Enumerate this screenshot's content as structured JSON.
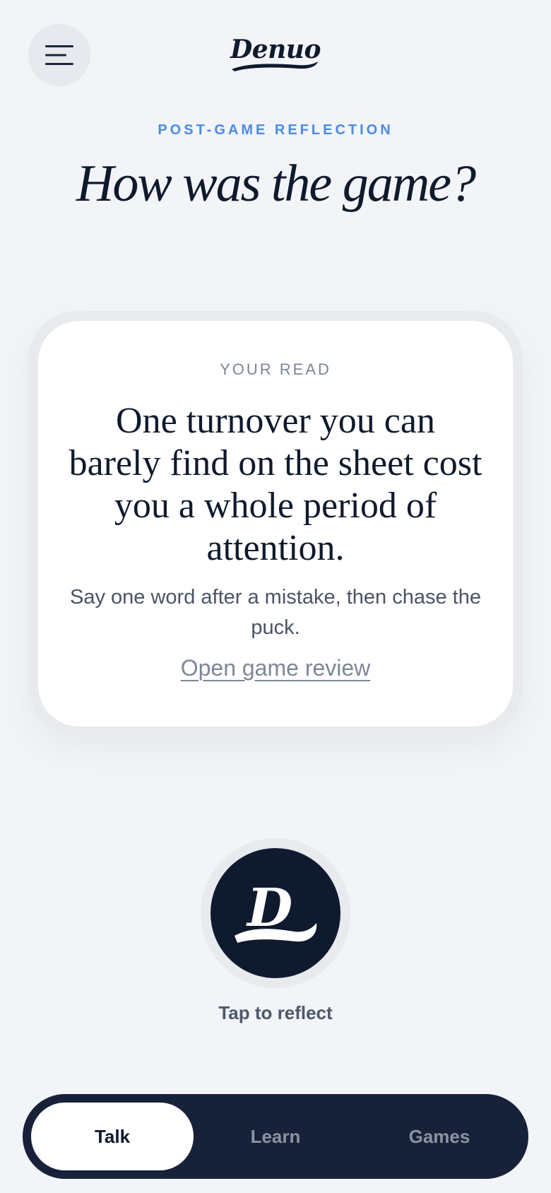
{
  "header": {
    "menu_icon": "hamburger-menu-icon",
    "logo_text": "Denuo"
  },
  "hero": {
    "eyebrow": "POST-GAME REFLECTION",
    "title": "How was the game?"
  },
  "card": {
    "label": "YOUR READ",
    "quote": "One turnover you can barely find on the sheet cost you a whole period of attention.",
    "subtext": "Say one word after a mistake, then chase the puck.",
    "link_label": "Open game review"
  },
  "reflect": {
    "icon": "denuo-d-logo-icon",
    "label": "Tap to reflect"
  },
  "tabs": [
    {
      "label": "Talk",
      "active": true
    },
    {
      "label": "Learn",
      "active": false
    },
    {
      "label": "Games",
      "active": false
    }
  ],
  "colors": {
    "background": "#f2f4f7",
    "navy": "#0f1a2e",
    "accent_blue": "#4a8be6",
    "tabbar": "#17223a"
  }
}
